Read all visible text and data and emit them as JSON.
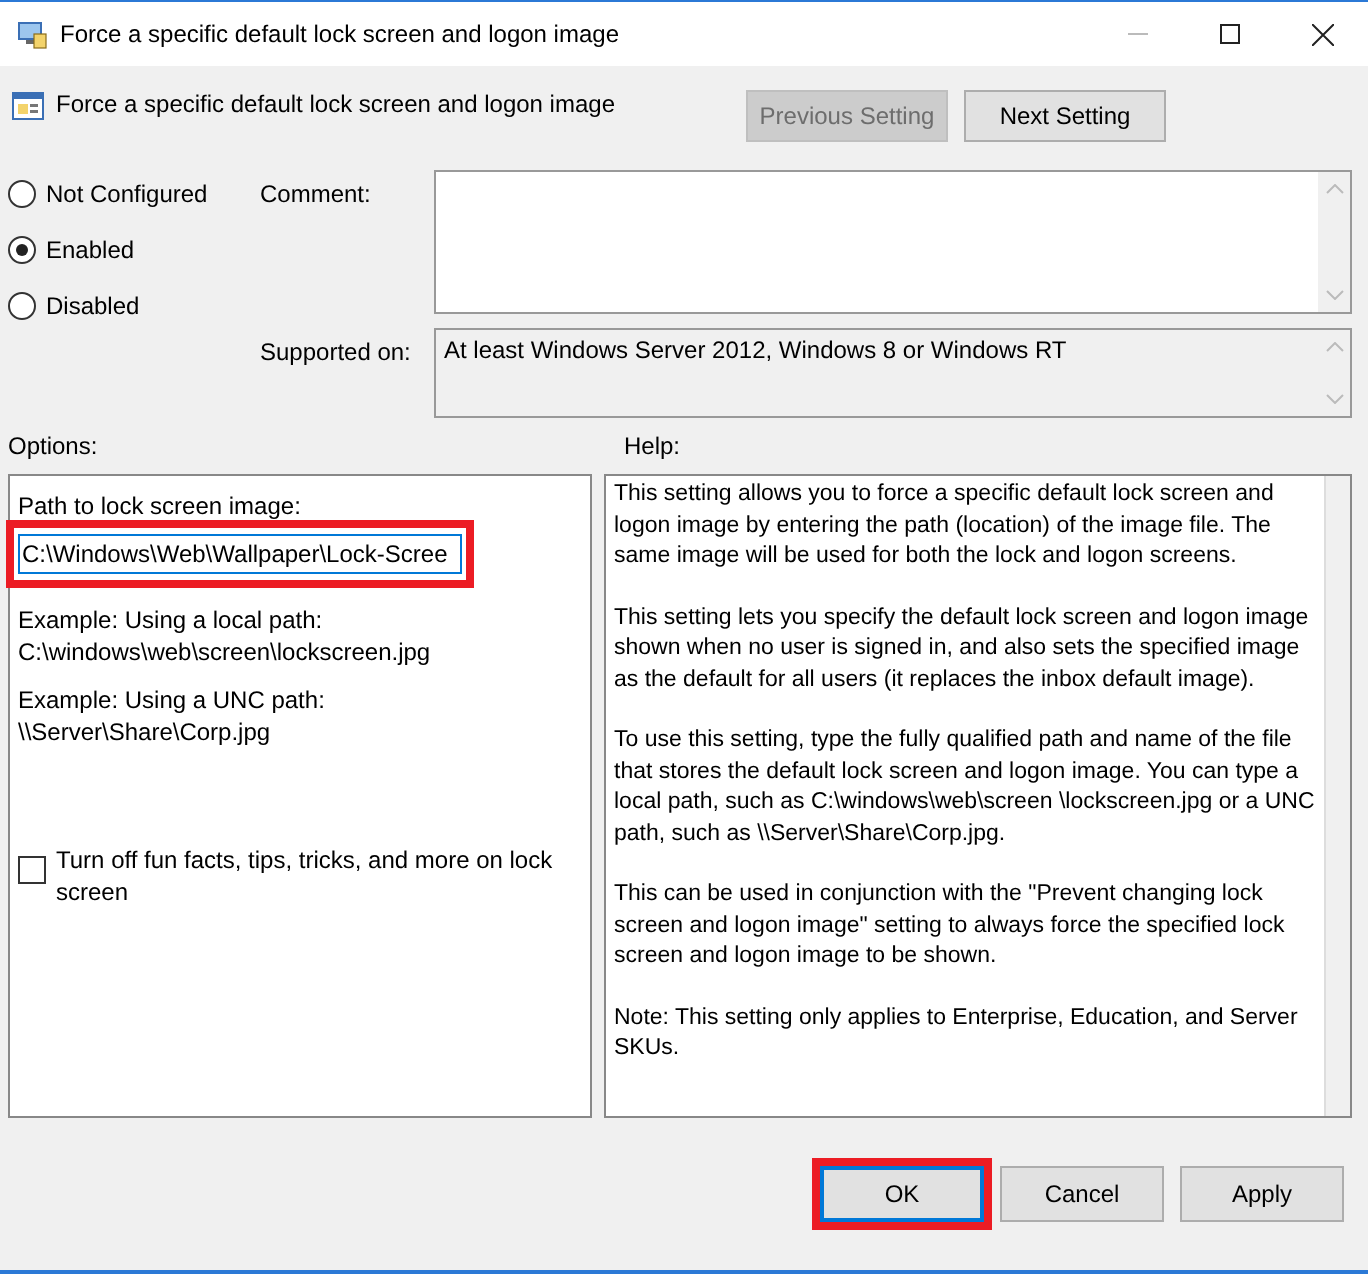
{
  "window": {
    "title": "Force a specific default lock screen and logon image"
  },
  "header": {
    "title": "Force a specific default lock screen and logon image",
    "buttons": [
      {
        "label": "Previous Setting",
        "disabled": true
      },
      {
        "label": "Next Setting",
        "disabled": false
      }
    ]
  },
  "state_options": [
    {
      "label": "Not Configured",
      "selected": false
    },
    {
      "label": "Enabled",
      "selected": true
    },
    {
      "label": "Disabled",
      "selected": false
    }
  ],
  "comment": {
    "label": "Comment:"
  },
  "supported_on": {
    "label": "Supported on:",
    "value": "At least Windows Server 2012, Windows 8 or Windows RT"
  },
  "options": {
    "label": "Options:",
    "path_label": "Path to lock screen image:",
    "path_value": "C:\\Windows\\Web\\Wallpaper\\Lock-Scree",
    "path_highlighted": true,
    "examples": [
      "Example: Using a local path:\nC:\\windows\\web\\screen\\lockscreen.jpg",
      "Example: Using a UNC path:\n\\\\Server\\Share\\Corp.jpg"
    ],
    "checkbox": {
      "label": "Turn off fun facts, tips, tricks, and more on lock screen",
      "checked": false
    }
  },
  "help": {
    "label": "Help:",
    "paragraphs": [
      "This setting allows you to force a specific default lock screen and logon image by entering the path (location) of the image file. The same image will be used for both the lock and logon screens.",
      "This setting lets you specify the default lock screen and logon image shown when no user is signed in, and also sets the specified image as the default for all users (it replaces the inbox default image).",
      "To use this setting, type the fully qualified path and name of the file that stores the default lock screen and logon image. You can type a local path, such as C:\\windows\\web\\screen \\lockscreen.jpg or a UNC path, such as \\\\Server\\Share\\Corp.jpg.",
      "This can be used in conjunction with the \"Prevent changing lock screen and logon image\" setting to always force the specified lock screen and logon image to be shown.",
      "Note: This setting only applies to Enterprise, Education, and Server SKUs."
    ]
  },
  "footer_buttons": [
    {
      "label": "OK",
      "default": true,
      "highlighted": true
    },
    {
      "label": "Cancel",
      "default": false,
      "highlighted": false
    },
    {
      "label": "Apply",
      "default": false,
      "highlighted": false
    }
  ]
}
